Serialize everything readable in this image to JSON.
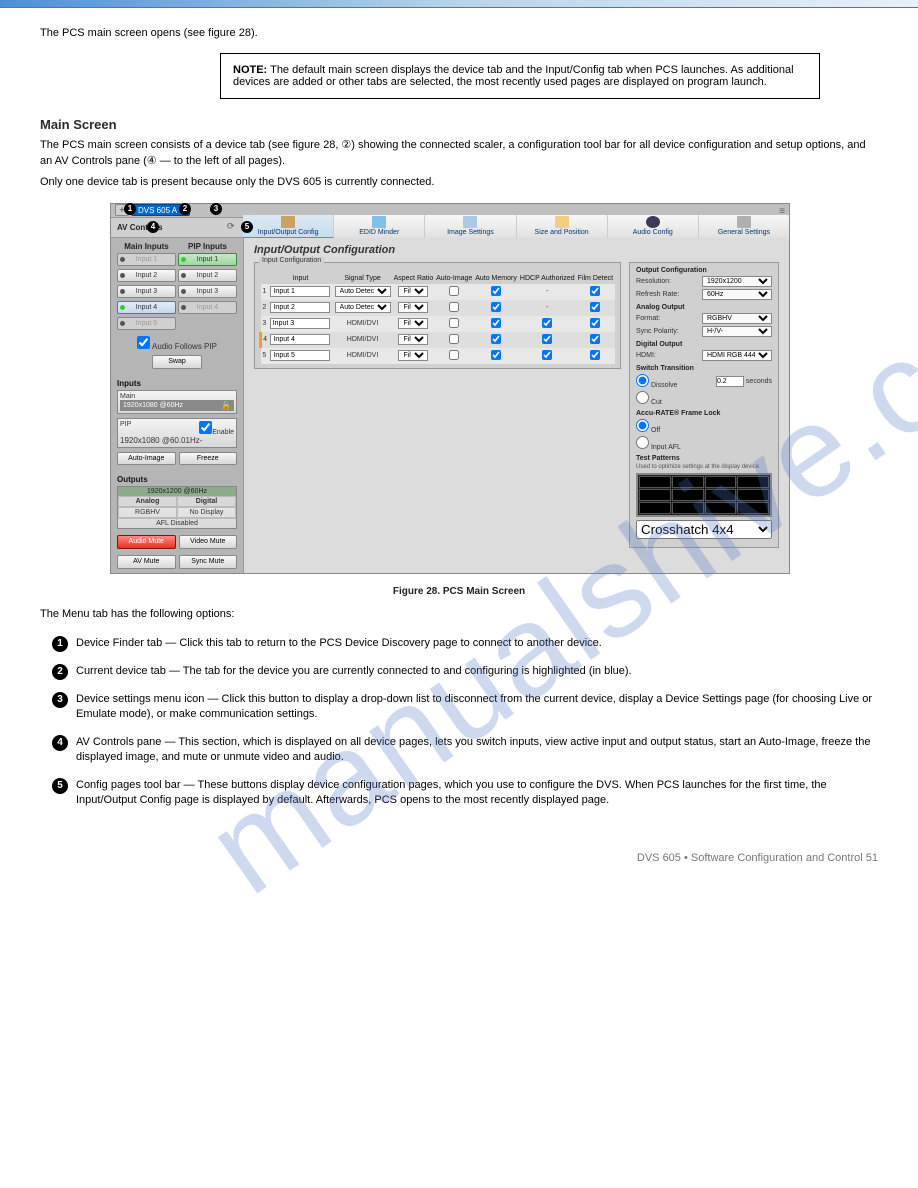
{
  "doc": {
    "intro": "The PCS main screen opens (see figure 28).",
    "note_label": "NOTE:",
    "note_text": "The default main screen displays the device tab and the Input/Config tab when PCS launches. As additional devices are added or other tabs are selected, the most recently used pages are displayed on program launch.",
    "h2": "Main Screen",
    "p1": "The PCS main screen consists of a device tab (see figure 28, ②) showing the connected scaler, a configuration tool bar for all device configuration and setup options, and an AV Controls pane (④ — to the left of all pages).",
    "p2": "Only one device tab is present because only the DVS 605 is currently connected.",
    "legend_heading": "The Menu tab has the following options:",
    "figure_caption": "Figure 28.   PCS Main Screen",
    "callouts": [
      {
        "num": "1",
        "text": "Device Finder tab  —  Click this tab to return to the PCS Device Discovery page to connect to another device."
      },
      {
        "num": "2",
        "text": "Current device tab  —  The tab for the device you are currently connected to and configuring is highlighted (in blue)."
      },
      {
        "num": "3",
        "text": "Device settings menu icon  —  Click this button to display a drop-down list to disconnect from the current device, display a Device Settings page (for choosing Live or Emulate mode), or make communication settings."
      },
      {
        "num": "4",
        "text": "AV Controls pane  —  This section, which is displayed on all device pages, lets you switch inputs, view active input and output status, start an Auto-Image, freeze the displayed image, and mute or unmute video and audio."
      },
      {
        "num": "5",
        "text": "Config pages tool bar  —  These buttons display device configuration pages, which you use to configure the DVS. When PCS launches for the first time, the Input/Output Config page is displayed by default. Afterwards, PCS opens to the most recently displayed page."
      }
    ]
  },
  "app": {
    "device_chip": "DVS 605 A",
    "av_controls": "AV Controls",
    "sidebar": {
      "main_inputs": "Main Inputs",
      "pip_inputs": "PIP Inputs",
      "inputs": [
        "Input 1",
        "Input 2",
        "Input 3",
        "Input 4",
        "Input 5"
      ],
      "audio_follows_pip": "Audio Follows PIP",
      "swap": "Swap",
      "inputs_title": "Inputs",
      "main_label": "Main",
      "main_val": "1920x1080 @60Hz",
      "pip_label": "PIP",
      "enable": "Enable",
      "pip_val": "1920x1080 @60.01Hz",
      "auto_image": "Auto-Image",
      "freeze": "Freeze",
      "outputs_title": "Outputs",
      "out_res": "1920x1200 @60Hz",
      "analog": "Analog",
      "digital": "Digital",
      "analog_val": "RGBHV",
      "digital_val": "No Display",
      "afl": "AFL Disabled",
      "audio_mute": "Audio Mute",
      "video_mute": "Video Mute",
      "av_mute": "AV Mute",
      "sync_mute": "Sync Mute"
    },
    "toolbar": [
      "Input/Output Config",
      "EDID Minder",
      "Image Settings",
      "Size and Position",
      "Audio Config",
      "General Settings"
    ],
    "center": {
      "title": "Input/Output Configuration",
      "legend": "Input Configuration",
      "cols": [
        "",
        "Input",
        "Signal Type",
        "Aspect Ratio",
        "Auto-Image",
        "Auto Memory",
        "HDCP Authorized",
        "Film Detect"
      ],
      "auto_detect": "Auto Detect",
      "hdmi_dvi": "HDMI/DVI",
      "fill": "Fill",
      "rows": [
        {
          "n": "1",
          "name": "Input 1",
          "sig": "Auto Detect",
          "sel": false,
          "ai": false,
          "am": true,
          "ha": "-",
          "fd": true,
          "editableSig": true
        },
        {
          "n": "2",
          "name": "Input 2",
          "sig": "Auto Detect",
          "sel": false,
          "ai": false,
          "am": true,
          "ha": "-",
          "fd": true,
          "editableSig": true
        },
        {
          "n": "3",
          "name": "Input 3",
          "sig": "HDMI/DVI",
          "sel": false,
          "ai": false,
          "am": true,
          "ha": true,
          "fd": true,
          "editableSig": false
        },
        {
          "n": "4",
          "name": "Input 4",
          "sig": "HDMI/DVI",
          "sel": true,
          "ai": false,
          "am": true,
          "ha": true,
          "fd": true,
          "editableSig": false
        },
        {
          "n": "5",
          "name": "Input 5",
          "sig": "HDMI/DVI",
          "sel": false,
          "ai": false,
          "am": true,
          "ha": true,
          "fd": true,
          "editableSig": false
        }
      ]
    },
    "right": {
      "out_cfg": "Output Configuration",
      "resolution_l": "Resolution:",
      "resolution_v": "1920x1200",
      "refresh_l": "Refresh Rate:",
      "refresh_v": "60Hz",
      "analog_out": "Analog Output",
      "format_l": "Format:",
      "format_v": "RGBHV",
      "sync_l": "Sync Polarity:",
      "sync_v": "H-/V-",
      "digital_out": "Digital Output",
      "hdmi_l": "HDMI:",
      "hdmi_v": "HDMI RGB 444",
      "switch_trans": "Switch Transition",
      "dissolve": "Dissolve",
      "cut": "Cut",
      "sec_val": "0.2",
      "seconds": "seconds",
      "afl_title": "Accu-RATE® Frame Lock",
      "off": "Off",
      "input_afl": "Input AFL",
      "test_patterns": "Test Patterns",
      "tp_hint": "Used to optimize settings at the display device",
      "tp_sel": "Crosshatch 4x4"
    }
  },
  "footer": "DVS 605 • Software Configuration and Control         51"
}
